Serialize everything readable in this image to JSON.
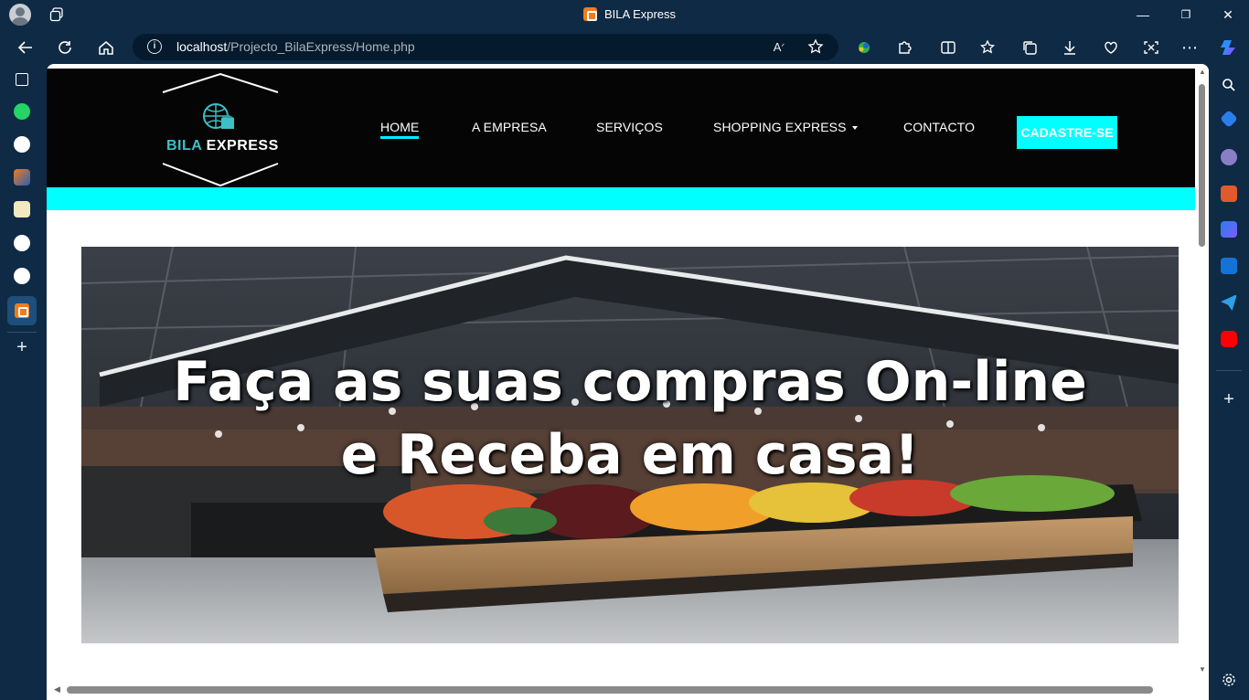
{
  "window": {
    "title": "BILA Express",
    "minimize": "—",
    "maximize": "❐",
    "close": "✕"
  },
  "toolbar": {
    "url_host": "localhost",
    "url_path": "/Projecto_BilaExpress/Home.php",
    "info": "i"
  },
  "site": {
    "logo": {
      "brand_part1": "BILA",
      "brand_part2": " EXPRESS"
    },
    "nav": {
      "items": [
        {
          "label": "HOME"
        },
        {
          "label": "A EMPRESA"
        },
        {
          "label": "SERVIÇOS"
        },
        {
          "label": "SHOPPING EXPRESS"
        },
        {
          "label": "CONTACTO"
        }
      ],
      "cta": "CADASTRE-SE"
    },
    "hero": {
      "line1": "Faça as suas compras On-line",
      "line2": "e Receba em casa!"
    }
  },
  "colors": {
    "accent": "#00ffff",
    "header_bg": "#050505",
    "browser_chrome": "#0f2a44"
  }
}
